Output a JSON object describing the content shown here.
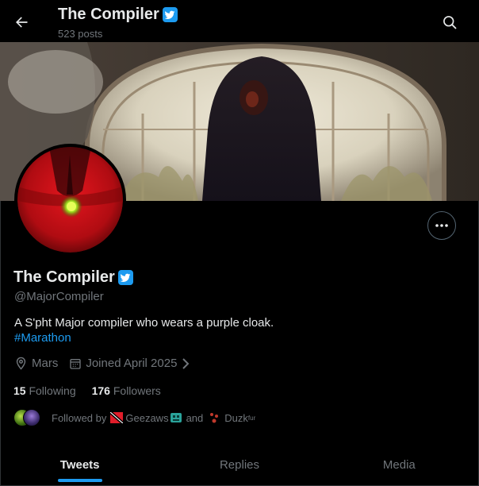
{
  "header": {
    "title": "The Compiler",
    "posts": "523 posts"
  },
  "profile": {
    "name": "The Compiler",
    "handle": "@MajorCompiler",
    "bio": "A S'pht Major compiler who wears a purple cloak.",
    "hashtag": "#Marathon",
    "location": "Mars",
    "joined": "Joined April 2025",
    "following_count": "15",
    "following_label": "Following",
    "followers_count": "176",
    "followers_label": "Followers"
  },
  "followed_by": {
    "prefix": "Followed by",
    "user1": "Geezaws",
    "conj": "and",
    "user2": "Duzk",
    "user2_sup": "fur"
  },
  "tabs": [
    {
      "label": "Tweets"
    },
    {
      "label": "Replies"
    },
    {
      "label": "Media"
    }
  ],
  "colors": {
    "accent": "#1d9bf0",
    "background": "#000000",
    "muted": "#71767b"
  }
}
